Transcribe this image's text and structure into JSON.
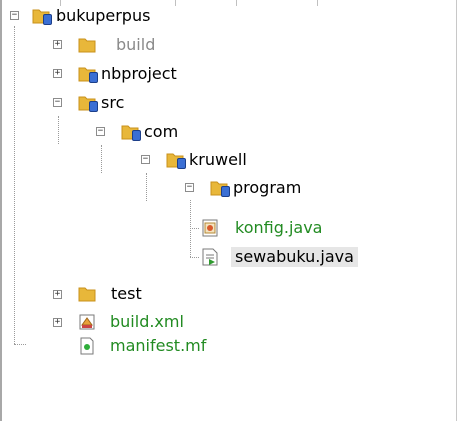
{
  "tree": {
    "root": {
      "label": "bukuperpus",
      "expander": "−"
    },
    "build": {
      "label": "build",
      "expander": "+"
    },
    "nbproject": {
      "label": "nbproject",
      "expander": "+"
    },
    "src": {
      "label": "src",
      "expander": "−"
    },
    "com": {
      "label": "com",
      "expander": "−"
    },
    "kruwell": {
      "label": "kruwell",
      "expander": "−"
    },
    "program": {
      "label": "program",
      "expander": "−"
    },
    "konfig": {
      "label": "konfig.java"
    },
    "sewabuku": {
      "label": "sewabuku.java"
    },
    "test": {
      "label": "test",
      "expander": "+"
    },
    "buildxml": {
      "label": "build.xml",
      "expander": "+"
    },
    "manifest": {
      "label": "manifest.mf"
    }
  },
  "icons": {
    "folder": "folder-icon",
    "package": "package-badge-icon",
    "java-form": "java-form-icon",
    "java-class": "java-class-icon",
    "ant-xml": "ant-build-icon",
    "manifest": "manifest-file-icon"
  },
  "colors": {
    "folder": "#e8b73a",
    "folder_dark": "#c9911b",
    "badge": "#3b6fd4",
    "green_text": "#228b22",
    "grey_text": "#8a8a8a"
  }
}
